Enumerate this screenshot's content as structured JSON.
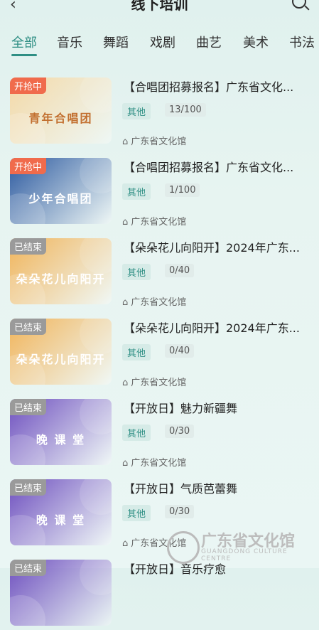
{
  "header": {
    "title": "线下培训"
  },
  "tabs": [
    "全部",
    "音乐",
    "舞蹈",
    "戏剧",
    "曲艺",
    "美术",
    "书法"
  ],
  "items": [
    {
      "status": "开抢中",
      "status_color": "#f06b4c",
      "thumb_text": "青年合唱团",
      "thumb_bg": "#f4d9a7",
      "title": "【合唱团招募报名】广东省文化...",
      "tag": "其他",
      "count": "13/100",
      "org": "广东省文化馆"
    },
    {
      "status": "开抢中",
      "status_color": "#f06b4c",
      "thumb_text": "少年合唱团",
      "thumb_bg": "#2d5aa0",
      "title": "【合唱团招募报名】广东省文化...",
      "tag": "其他",
      "count": "1/100",
      "org": "广东省文化馆"
    },
    {
      "status": "已结束",
      "status_color": "#9a9a9a",
      "thumb_text": "朵朵花儿向阳开",
      "thumb_bg": "#f1b45a",
      "title": "【朵朵花儿向阳开】2024年广东...",
      "tag": "其他",
      "count": "0/40",
      "org": "广东省文化馆"
    },
    {
      "status": "已结束",
      "status_color": "#9a9a9a",
      "thumb_text": "朵朵花儿向阳开",
      "thumb_bg": "#f1b45a",
      "title": "【朵朵花儿向阳开】2024年广东...",
      "tag": "其他",
      "count": "0/40",
      "org": "广东省文化馆"
    },
    {
      "status": "已结束",
      "status_color": "#9a9a9a",
      "thumb_text": "晚 课 堂",
      "thumb_bg": "#6e4fbf",
      "title": "【开放日】魅力新疆舞",
      "tag": "其他",
      "count": "0/30",
      "org": "广东省文化馆"
    },
    {
      "status": "已结束",
      "status_color": "#9a9a9a",
      "thumb_text": "晚 课 堂",
      "thumb_bg": "#6e4fbf",
      "title": "【开放日】气质芭蕾舞",
      "tag": "其他",
      "count": "0/30",
      "org": "广东省文化馆"
    },
    {
      "status": "已结束",
      "status_color": "#9a9a9a",
      "thumb_text": "",
      "thumb_bg": "#6e4fbf",
      "title": "【开放日】音乐疗愈",
      "tag": "",
      "count": "",
      "org": ""
    }
  ],
  "watermark": {
    "text": "广东省文化馆",
    "sub": "GUANGDONG CULTURE CENTRE"
  }
}
